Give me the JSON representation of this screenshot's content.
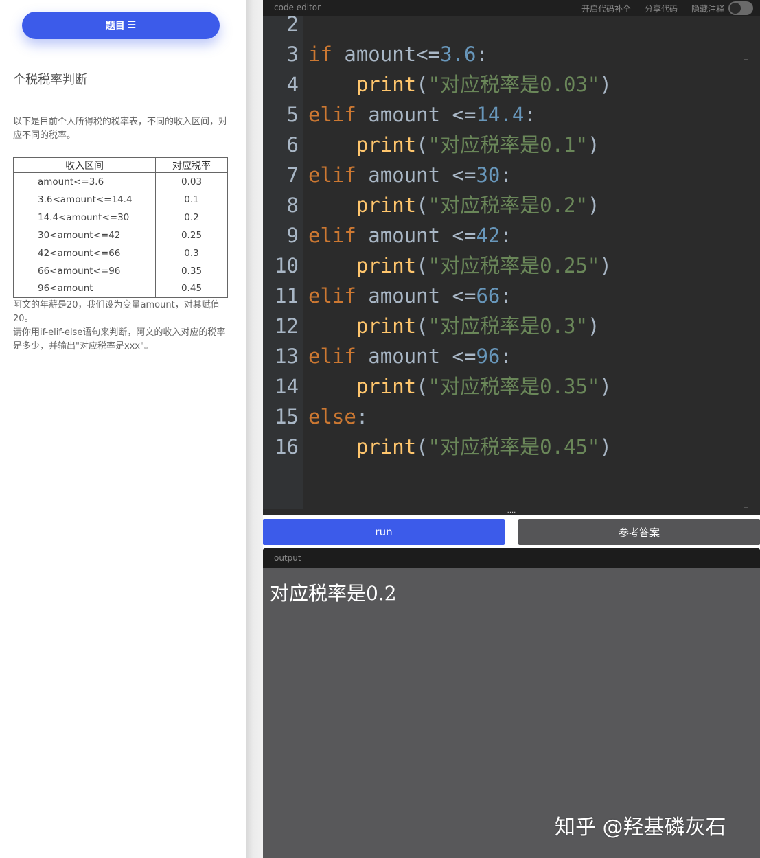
{
  "sidebar": {
    "topic_button_label": "题目",
    "topic_button_icon": "menu-list-icon",
    "problem_title": "个税税率判断",
    "description": "以下是目前个人所得税的税率表，不同的收入区间，对应不同的税率。",
    "table": {
      "headers": [
        "收入区间",
        "对应税率"
      ],
      "rows": [
        [
          "amount<=3.6",
          "0.03"
        ],
        [
          "3.6<amount<=14.4",
          "0.1"
        ],
        [
          "14.4<amount<=30",
          "0.2"
        ],
        [
          "30<amount<=42",
          "0.25"
        ],
        [
          "42<amount<=66",
          "0.3"
        ],
        [
          "66<amount<=96",
          "0.35"
        ],
        [
          "96<amount",
          "0.45"
        ]
      ]
    },
    "note_line1": "阿文的年薪是20，我们设为变量amount，对其赋值20。",
    "note_line2": "请你用if-elif-else语句来判断，阿文的收入对应的税率是多少，并输出\"对应税率是xxx\"。"
  },
  "editor": {
    "title": "code editor",
    "actions": [
      "开启代码补全",
      "分享代码",
      "隐藏注释"
    ],
    "comment_toggle_on": false,
    "resize_handle": "....",
    "lines": [
      {
        "n": "2",
        "tokens": []
      },
      {
        "n": "3",
        "tokens": [
          [
            "kw",
            "if"
          ],
          [
            "plain",
            " amount<="
          ],
          [
            "num",
            "3.6"
          ],
          [
            "plain",
            ":"
          ]
        ]
      },
      {
        "n": "4",
        "tokens": [
          [
            "plain",
            "    "
          ],
          [
            "fn",
            "print"
          ],
          [
            "plain",
            "("
          ],
          [
            "str",
            "\"对应税率是0.03\""
          ],
          [
            "plain",
            ")"
          ]
        ]
      },
      {
        "n": "5",
        "tokens": [
          [
            "kw",
            "elif"
          ],
          [
            "plain",
            " amount <="
          ],
          [
            "num",
            "14.4"
          ],
          [
            "plain",
            ":"
          ]
        ]
      },
      {
        "n": "6",
        "tokens": [
          [
            "plain",
            "    "
          ],
          [
            "fn",
            "print"
          ],
          [
            "plain",
            "("
          ],
          [
            "str",
            "\"对应税率是0.1\""
          ],
          [
            "plain",
            ")"
          ]
        ]
      },
      {
        "n": "7",
        "tokens": [
          [
            "kw",
            "elif"
          ],
          [
            "plain",
            " amount <="
          ],
          [
            "num",
            "30"
          ],
          [
            "plain",
            ":"
          ]
        ]
      },
      {
        "n": "8",
        "tokens": [
          [
            "plain",
            "    "
          ],
          [
            "fn",
            "print"
          ],
          [
            "plain",
            "("
          ],
          [
            "str",
            "\"对应税率是0.2\""
          ],
          [
            "plain",
            ")"
          ]
        ]
      },
      {
        "n": "9",
        "tokens": [
          [
            "kw",
            "elif"
          ],
          [
            "plain",
            " amount <="
          ],
          [
            "num",
            "42"
          ],
          [
            "plain",
            ":"
          ]
        ]
      },
      {
        "n": "10",
        "tokens": [
          [
            "plain",
            "    "
          ],
          [
            "fn",
            "print"
          ],
          [
            "plain",
            "("
          ],
          [
            "str",
            "\"对应税率是0.25\""
          ],
          [
            "plain",
            ")"
          ]
        ]
      },
      {
        "n": "11",
        "tokens": [
          [
            "kw",
            "elif"
          ],
          [
            "plain",
            " amount <="
          ],
          [
            "num",
            "66"
          ],
          [
            "plain",
            ":"
          ]
        ]
      },
      {
        "n": "12",
        "tokens": [
          [
            "plain",
            "    "
          ],
          [
            "fn",
            "print"
          ],
          [
            "plain",
            "("
          ],
          [
            "str",
            "\"对应税率是0.3\""
          ],
          [
            "plain",
            ")"
          ]
        ]
      },
      {
        "n": "13",
        "tokens": [
          [
            "kw",
            "elif"
          ],
          [
            "plain",
            " amount <="
          ],
          [
            "num",
            "96"
          ],
          [
            "plain",
            ":"
          ]
        ]
      },
      {
        "n": "14",
        "tokens": [
          [
            "plain",
            "    "
          ],
          [
            "fn",
            "print"
          ],
          [
            "plain",
            "("
          ],
          [
            "str",
            "\"对应税率是0.35\""
          ],
          [
            "plain",
            ")"
          ]
        ]
      },
      {
        "n": "15",
        "tokens": [
          [
            "kw",
            "else"
          ],
          [
            "plain",
            ":"
          ]
        ]
      },
      {
        "n": "16",
        "tokens": [
          [
            "plain",
            "    "
          ],
          [
            "fn",
            "print"
          ],
          [
            "plain",
            "("
          ],
          [
            "str",
            "\"对应税率是0.45\""
          ],
          [
            "plain",
            ")"
          ]
        ]
      }
    ]
  },
  "buttons": {
    "run_label": "run",
    "answer_label": "参考答案"
  },
  "output": {
    "title": "output",
    "text": "对应税率是0.2"
  },
  "watermark": "知乎 @羟基磷灰石",
  "colors": {
    "accent": "#3c5bea",
    "editor_bg": "#2b2b2b",
    "keyword": "#cc7832",
    "number": "#6897bb",
    "function": "#ffc66d",
    "string": "#6a8759",
    "output_bg": "#58585a"
  }
}
